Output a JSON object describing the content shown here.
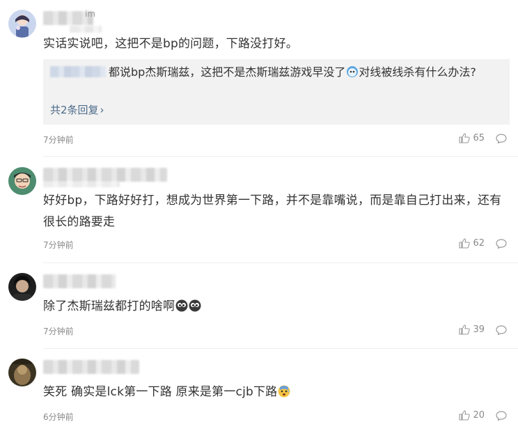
{
  "comments": [
    {
      "name_fragment": "im",
      "text": "实话实说吧，这把不是bp的问题，下路没打好。",
      "reply": {
        "text": "都说bp杰斯瑞兹，这把不是杰斯瑞兹游戏早没了",
        "text_after_emoji": "对线被线杀有什么办法?",
        "more": "共2条回复",
        "more_chevron": "›"
      },
      "time": "7分钟前",
      "likes": "65"
    },
    {
      "text": "好好bp，下路好好打，想成为世界第一下路，并不是靠嘴说，而是靠自己打出来，还有很长的路要走",
      "time": "7分钟前",
      "likes": "62"
    },
    {
      "text": "除了杰斯瑞兹都打的啥啊",
      "time": "7分钟前",
      "likes": "39"
    },
    {
      "text": "笑死 确实是lck第一下路 原来是第一cjb下路",
      "time": "6分钟前",
      "likes": "20"
    }
  ],
  "icons": {
    "like": "thumbs-up-icon",
    "reply": "speech-bubble-icon"
  },
  "colors": {
    "link": "#4d6b8a",
    "meta": "#8a8a8a",
    "reply_bg": "#f2f2f2"
  }
}
